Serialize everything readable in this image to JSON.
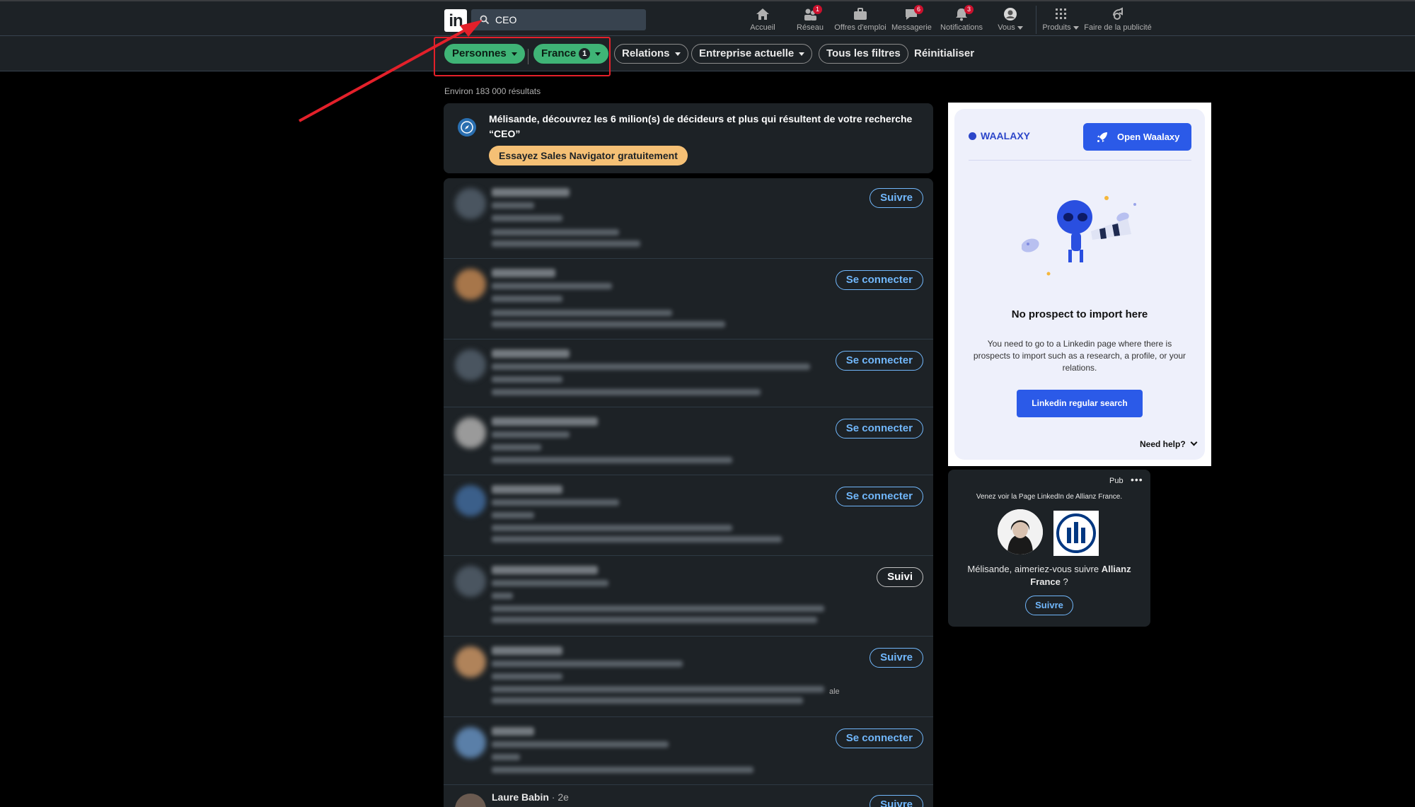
{
  "search": {
    "value": "CEO",
    "icon": "search-icon"
  },
  "nav": {
    "items": [
      {
        "label": "Accueil",
        "icon": "home-icon",
        "badge": ""
      },
      {
        "label": "Réseau",
        "icon": "network-icon",
        "badge": "1"
      },
      {
        "label": "Offres d'emploi",
        "icon": "briefcase-icon",
        "badge": ""
      },
      {
        "label": "Messagerie",
        "icon": "messaging-icon",
        "badge": "6"
      },
      {
        "label": "Notifications",
        "icon": "bell-icon",
        "badge": "3"
      },
      {
        "label": "Vous",
        "icon": "avatar-icon",
        "badge": ""
      },
      {
        "label": "Produits",
        "icon": "grid-icon",
        "badge": ""
      },
      {
        "label": "Faire de la publicité",
        "icon": "advertise-icon",
        "badge": ""
      }
    ]
  },
  "filters": {
    "personnes": "Personnes",
    "france": "France",
    "france_count": "1",
    "relations": "Relations",
    "entreprise": "Entreprise actuelle",
    "tous": "Tous les filtres",
    "reset": "Réinitialiser"
  },
  "results_count": "Environ 183 000 résultats",
  "promo": {
    "text": "Mélisande, découvrez les 6 milion(s) de décideurs et plus qui résultent de votre recherche “CEO”",
    "button": "Essayez Sales Navigator gratuitement"
  },
  "results": [
    {
      "action": "Suivre"
    },
    {
      "action": "Se connecter"
    },
    {
      "action": "Se connecter"
    },
    {
      "action": "Se connecter"
    },
    {
      "action": "Se connecter"
    },
    {
      "action": "Suivi"
    },
    {
      "action": "Suivre"
    },
    {
      "action": "Se connecter"
    },
    {
      "action": "Suivre"
    }
  ],
  "last_result": {
    "name": "Laure Babin",
    "degree": " · 2e"
  },
  "stray_text": "ale",
  "waalaxy": {
    "logo": "WAALAXY",
    "open_button": "Open Waalaxy",
    "title": "No prospect to import here",
    "description": "You need to go to a Linkedin page where there is prospects to import such as a research, a profile, or your relations.",
    "button": "Linkedin regular search",
    "help": "Need help?"
  },
  "ad": {
    "pub": "Pub",
    "line": "Venez voir la Page LinkedIn de Allianz France.",
    "question_pre": "Mélisande, aimeriez-vous suivre ",
    "question_bold": "Allianz France",
    "question_post": " ?",
    "button": "Suivre"
  },
  "colors": {
    "accent_green": "#3fb476",
    "link_blue": "#71b7fb",
    "annotation_red": "#e3202a",
    "waalaxy_blue": "#2b5ae8"
  }
}
